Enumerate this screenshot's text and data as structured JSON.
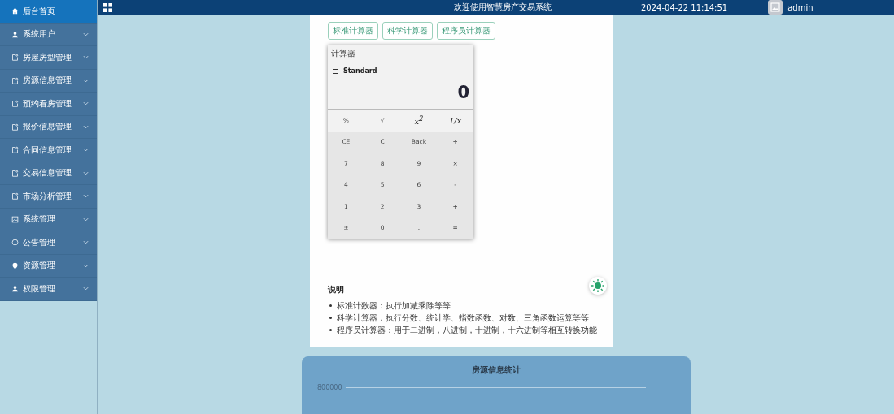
{
  "sidebar": {
    "items": [
      {
        "label": "后台首页",
        "kind": "home",
        "selected": true,
        "expandable": false
      },
      {
        "label": "系统用户",
        "kind": "user",
        "selected": false,
        "expandable": true
      },
      {
        "label": "房屋房型管理",
        "kind": "doc",
        "selected": false,
        "expandable": true
      },
      {
        "label": "房源信息管理",
        "kind": "doc",
        "selected": false,
        "expandable": true
      },
      {
        "label": "预约看房管理",
        "kind": "doc",
        "selected": false,
        "expandable": true
      },
      {
        "label": "报价信息管理",
        "kind": "doc",
        "selected": false,
        "expandable": true
      },
      {
        "label": "合同信息管理",
        "kind": "doc",
        "selected": false,
        "expandable": true
      },
      {
        "label": "交易信息管理",
        "kind": "doc",
        "selected": false,
        "expandable": true
      },
      {
        "label": "市场分析管理",
        "kind": "doc",
        "selected": false,
        "expandable": true
      },
      {
        "label": "系统管理",
        "kind": "image",
        "selected": false,
        "expandable": true
      },
      {
        "label": "公告管理",
        "kind": "info",
        "selected": false,
        "expandable": true
      },
      {
        "label": "资源管理",
        "kind": "pin",
        "selected": false,
        "expandable": true
      },
      {
        "label": "权限管理",
        "kind": "user",
        "selected": false,
        "expandable": true
      }
    ]
  },
  "topbar": {
    "title": "欢迎使用智慧房产交易系统",
    "datetime": "2024-04-22 11:14:51",
    "user": "admin"
  },
  "calculator_tabs": [
    "标准计算器",
    "科学计算器",
    "程序员计算器"
  ],
  "calculator": {
    "title": "计算器",
    "mode": "Standard",
    "display": "0",
    "keys": [
      {
        "label": "%",
        "kind": "fn"
      },
      {
        "label": "√",
        "kind": "fn"
      },
      {
        "label": "*x*$^{2}$",
        "kind": "fn"
      },
      {
        "label": "1/*x*",
        "kind": "fn"
      },
      {
        "label": "CE",
        "kind": "key"
      },
      {
        "label": "C",
        "kind": "key"
      },
      {
        "label": "Back",
        "kind": "key"
      },
      {
        "label": "÷",
        "kind": "key"
      },
      {
        "label": "7",
        "kind": "key"
      },
      {
        "label": "8",
        "kind": "key"
      },
      {
        "label": "9",
        "kind": "key"
      },
      {
        "label": "×",
        "kind": "key"
      },
      {
        "label": "4",
        "kind": "key"
      },
      {
        "label": "5",
        "kind": "key"
      },
      {
        "label": "6",
        "kind": "key"
      },
      {
        "label": "-",
        "kind": "key"
      },
      {
        "label": "1",
        "kind": "key"
      },
      {
        "label": "2",
        "kind": "key"
      },
      {
        "label": "3",
        "kind": "key"
      },
      {
        "label": "+",
        "kind": "key"
      },
      {
        "label": "±",
        "kind": "key"
      },
      {
        "label": "0",
        "kind": "key"
      },
      {
        "label": ".",
        "kind": "key"
      },
      {
        "label": "=",
        "kind": "key"
      }
    ]
  },
  "notes": {
    "heading": "说明",
    "items": [
      "标准计数器：执行加减乘除等等",
      "科学计算器：执行分数、统计学、指数函数、对数、三角函数运算等等",
      "程序员计算器：用于二进制，八进制，十进制，十六进制等相互转换功能"
    ]
  },
  "chart_panel": {
    "title": "房源信息统计",
    "axis_label": "800000"
  }
}
